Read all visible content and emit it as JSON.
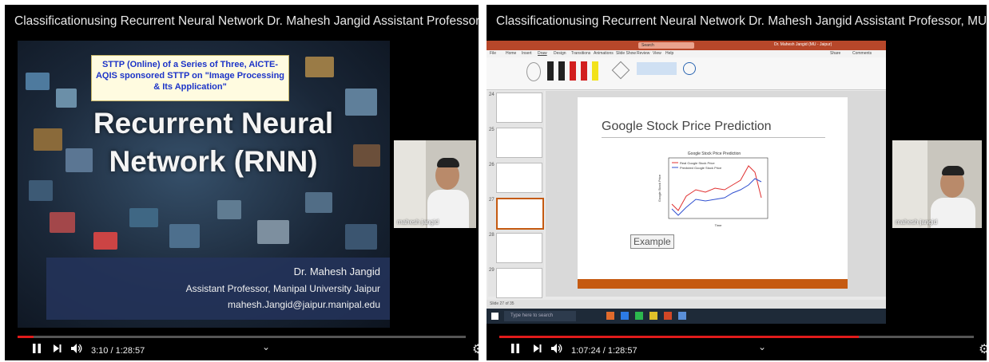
{
  "players": [
    {
      "title": "Classificationusing Recurrent Neural Network Dr. Mahesh Jangid Assistant Professor, MUJ",
      "time": "3:10 / 1:28:57",
      "progress": 0.036,
      "slide": {
        "banner_lines": [
          "STTP (Online) of a Series of Three, AICTE-",
          "AQIS sponsored STTP on \"Image Processing",
          "& Its Application\""
        ],
        "title_lines": [
          "Recurrent Neural",
          "Network (RNN)"
        ],
        "author_name": "Dr. Mahesh Jangid",
        "author_role": "Assistant Professor, Manipal University Jaipur",
        "author_email": "mahesh.Jangid@jaipur.manipal.edu"
      },
      "camera_label": "mahesh jangid"
    },
    {
      "title": "Classificationusing Recurrent Neural Network Dr. Mahesh Jangid Assistant Professor, MUJ",
      "time": "1:07:24 / 1:28:57",
      "progress": 0.758,
      "ppt": {
        "window_title": "Dr. Mahesh Jangid (MU - Jaipur)",
        "search": "Search",
        "tabs": [
          "File",
          "Home",
          "Insert",
          "Draw",
          "Design",
          "Transitions",
          "Animations",
          "Slide Show",
          "Review",
          "View",
          "Help"
        ],
        "share": "Share",
        "comments": "Comments",
        "slide_numbers": [
          "24",
          "25",
          "26",
          "27",
          "28",
          "29"
        ],
        "slide_title": "Google Stock Price Prediction",
        "chart_title": "Google Stock Price Prediction",
        "legend": [
          "Real Google Stock Price",
          "Predicted Google Stock Price"
        ],
        "x_label": "Time",
        "y_label": "Google Stock Price",
        "example_label": "Example",
        "status": "Slide 27 of 35",
        "taskbar_search": "Type here to search"
      },
      "camera_label": "mahesh jangid"
    }
  ],
  "colors": {
    "progress": "#e01b1b",
    "banner_text": "#1c34c8",
    "ppt_accent": "#b7472a",
    "slide_bar": "#c55a11"
  }
}
